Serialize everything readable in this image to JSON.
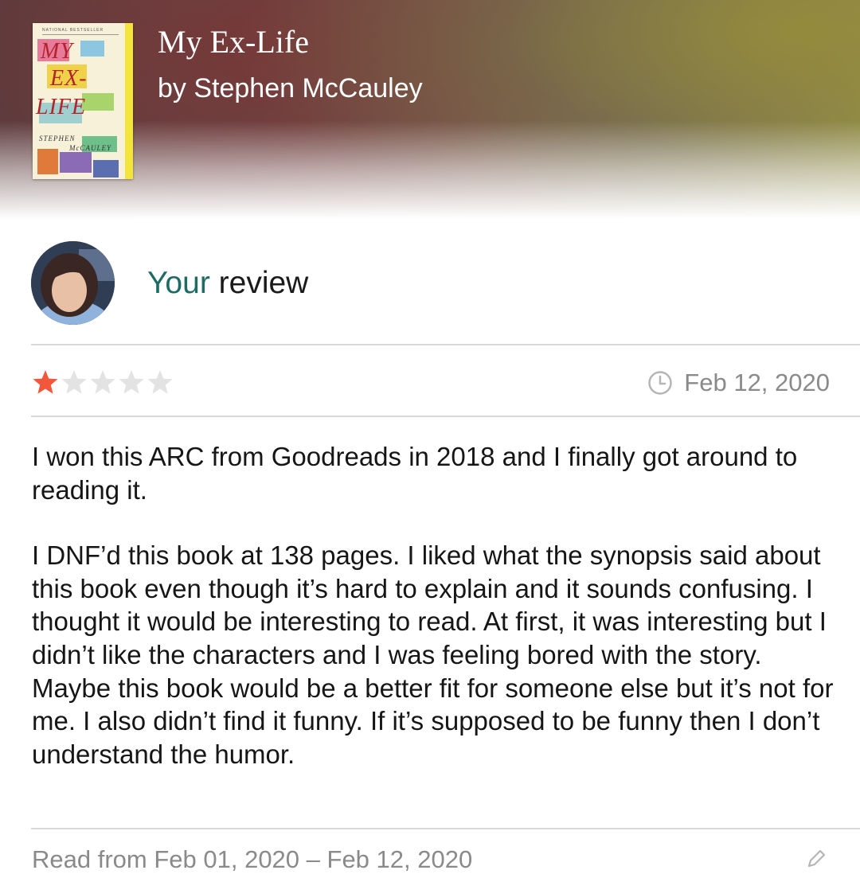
{
  "book": {
    "title": "My Ex-Life",
    "author": "by Stephen McCauley",
    "cover": {
      "title_lines": [
        "MY",
        "EX-",
        "LIFE"
      ],
      "author_lines": [
        "STEPHEN",
        "McCAULEY"
      ],
      "banner": "NATIONAL BESTSELLER"
    }
  },
  "review": {
    "heading_your": "Your",
    "heading_rest": " review",
    "rating": 1,
    "max_rating": 5,
    "star_color": "#f2573b",
    "star_empty_color": "#e3e3e3",
    "date": "Feb 12, 2020",
    "paragraphs": [
      "I won this ARC from Goodreads in 2018 and I finally got around to reading it.",
      "I DNF’d this book at 138 pages. I liked what the synopsis said about this book even though it’s hard to explain and it sounds confusing. I thought it would be interesting to read. At first, it was interesting but I didn’t like the characters and I was feeling bored with the story. Maybe this book would be a better fit for someone else but it’s not for me. I also didn’t find it funny. If it’s supposed to be funny then I don’t understand the humor."
    ],
    "read_dates": "Read from Feb 01, 2020 – Feb 12, 2020"
  },
  "colors": {
    "accent": "#1e6b63",
    "muted_text": "#8a8a8a",
    "divider": "#d8d8d8"
  },
  "icons": {
    "clock": "clock-icon",
    "edit": "pencil-icon"
  }
}
